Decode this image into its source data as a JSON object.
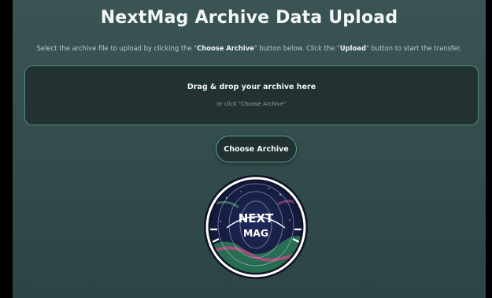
{
  "page": {
    "title": "NextMag Archive Data Upload",
    "instructions": {
      "part1": "Select the archive file to upload by clicking the \"",
      "choose_bold": "Choose Archive",
      "part2": "\" button below. Click the \"",
      "upload_bold": "Upload",
      "part3": "\" button to start the transfer."
    }
  },
  "dropzone": {
    "title": "Drag & drop your archive here",
    "subtitle": "or click \"Choose Archive\""
  },
  "buttons": {
    "choose_label": "Choose Archive"
  },
  "logo": {
    "line1": "NEXT",
    "line2": "MAG"
  },
  "colors": {
    "background": "#344d4e",
    "accent": "#56a48c",
    "dropzone_bg": "#223233",
    "logo_bg": "#151a3d"
  }
}
